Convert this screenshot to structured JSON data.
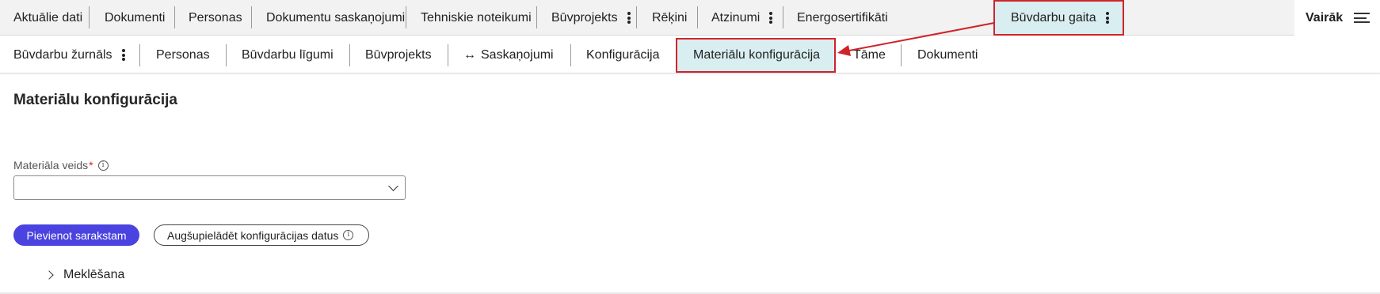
{
  "top_nav": {
    "tabs": [
      {
        "label": "Aktuālie dati"
      },
      {
        "label": "Dokumenti"
      },
      {
        "label": "Personas"
      },
      {
        "label": "Dokumentu saskaņojumi"
      },
      {
        "label": "Tehniskie noteikumi"
      },
      {
        "label": "Būvprojekts"
      },
      {
        "label": "Rēķini"
      },
      {
        "label": "Atzinumi"
      },
      {
        "label": "Energosertifikāti"
      },
      {
        "label": "Būvdarbu gaita"
      }
    ],
    "more_label": "Vairāk"
  },
  "sub_nav": {
    "tabs": [
      {
        "label": "Būvdarbu žurnāls"
      },
      {
        "label": "Personas"
      },
      {
        "label": "Būvdarbu līgumi"
      },
      {
        "label": "Būvprojekts"
      },
      {
        "label": "Saskaņojumi",
        "prefix": "↔"
      },
      {
        "label": "Konfigurācija"
      },
      {
        "label": "Materiālu konfigurācija"
      },
      {
        "label": "Tāme"
      },
      {
        "label": "Dokumenti"
      }
    ]
  },
  "main": {
    "title": "Materiālu konfigurācija",
    "material_field": {
      "label": "Materiāla veids",
      "required_mark": "*",
      "value": ""
    },
    "add_button": "Pievienot sarakstam",
    "upload_button": "Augšupielādēt konfigurācijas datus",
    "search_section": "Meklēšana"
  },
  "colors": {
    "active_tab_bg": "#d9eef0",
    "highlight_border": "#d0232a",
    "primary_button": "#4a43e0"
  }
}
